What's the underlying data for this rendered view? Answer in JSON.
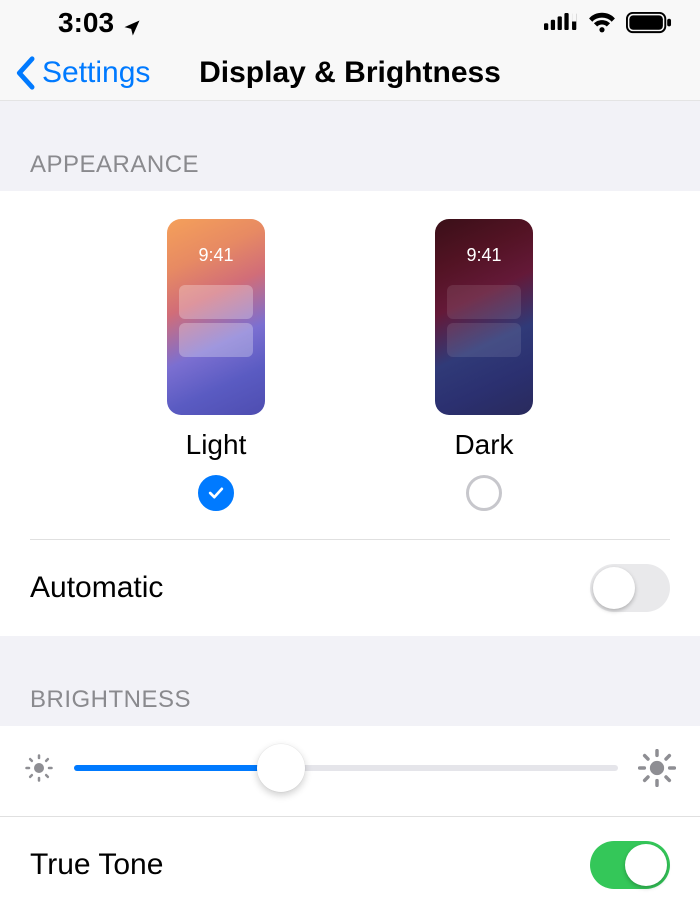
{
  "status": {
    "time": "3:03"
  },
  "nav": {
    "back": "Settings",
    "title": "Display & Brightness"
  },
  "appearance": {
    "header": "APPEARANCE",
    "preview_time": "9:41",
    "light_label": "Light",
    "dark_label": "Dark",
    "selected": "light",
    "automatic_label": "Automatic",
    "automatic_on": false
  },
  "brightness": {
    "header": "BRIGHTNESS",
    "value_percent": 38,
    "true_tone_label": "True Tone",
    "true_tone_on": true
  },
  "colors": {
    "accent": "#007aff",
    "toggle_on": "#34c759"
  }
}
